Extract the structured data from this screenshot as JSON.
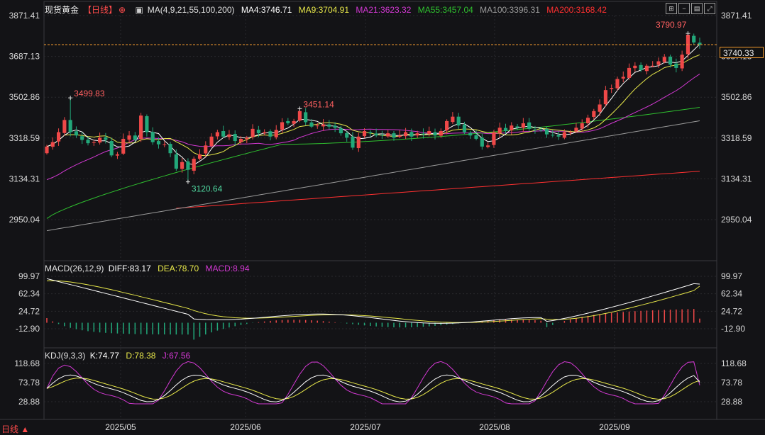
{
  "header": {
    "ticker": "现货黄金",
    "period": "【日线】",
    "period_icon": "target-icon",
    "ma_label": "MA(4,9,21,55,100,200)",
    "ma4": "MA4:3746.71",
    "ma9": "MA9:3704.91",
    "ma21": "MA21:3623.32",
    "ma55": "MA55:3457.04",
    "ma100": "MA100:3396.31",
    "ma200": "MA200:3168.42"
  },
  "toolbar": [
    "layout-icon",
    "minus-icon",
    "panel-icon",
    "expand-icon"
  ],
  "price_tag": "3740.33",
  "macd_header": {
    "label": "MACD(26,12,9)",
    "diff": "DIFF:83.17",
    "dea": "DEA:78.70",
    "macd": "MACD:8.94"
  },
  "kdj_header": {
    "label": "KDJ(9,3,3)",
    "k": "K:74.77",
    "d": "D:78.38",
    "j": "J:67.56"
  },
  "bottom_left": "日线 ▲",
  "colors": {
    "up": "#ef4848",
    "down": "#22a87a",
    "ma4": "#ffffff",
    "ma9": "#e8e84a",
    "ma21": "#d238d2",
    "ma55": "#2fc02f",
    "ma100": "#9a9a9a",
    "ma200": "#ff3030",
    "grid": "#2a2a2e",
    "axis_text": "#d8d8d8"
  },
  "chart_data": [
    {
      "type": "candlestick",
      "name": "price",
      "ticks_left": [
        "3871.41",
        "3687.13",
        "3502.86",
        "3318.59",
        "3134.31",
        "2950.04"
      ],
      "ticks_right": [
        "3871.41",
        "3687.13",
        "3502.86",
        "3318.59",
        "3134.31",
        "2950.04"
      ],
      "x_ticks": [
        "2025/05",
        "2025/06",
        "2025/07",
        "2025/08",
        "2025/09"
      ],
      "annotations": [
        {
          "label": "3499.83",
          "value": 3499.83,
          "color": "#ff6060"
        },
        {
          "label": "3451.14",
          "value": 3451.14,
          "color": "#ff6060"
        },
        {
          "label": "3120.64",
          "value": 3120.64,
          "color": "#4fd8a0"
        },
        {
          "label": "3790.97",
          "value": 3790.97,
          "color": "#ff6060"
        }
      ],
      "reference_line": 3740.33,
      "close": [
        3280,
        3300,
        3345,
        3400,
        3345,
        3330,
        3310,
        3295,
        3300,
        3320,
        3310,
        3240,
        3245,
        3315,
        3330,
        3310,
        3420,
        3345,
        3300,
        3290,
        3290,
        3250,
        3180,
        3210,
        3175,
        3225,
        3245,
        3285,
        3325,
        3345,
        3325,
        3335,
        3305,
        3315,
        3320,
        3360,
        3340,
        3345,
        3325,
        3355,
        3390,
        3385,
        3395,
        3440,
        3390,
        3370,
        3375,
        3380,
        3370,
        3365,
        3340,
        3320,
        3275,
        3325,
        3350,
        3340,
        3330,
        3330,
        3340,
        3320,
        3330,
        3345,
        3325,
        3340,
        3335,
        3350,
        3330,
        3350,
        3395,
        3415,
        3375,
        3345,
        3330,
        3315,
        3280,
        3285,
        3345,
        3365,
        3350,
        3375,
        3365,
        3385,
        3360,
        3355,
        3355,
        3335,
        3330,
        3325,
        3345,
        3345,
        3365,
        3385,
        3410,
        3440,
        3470,
        3535,
        3545,
        3585,
        3595,
        3635,
        3645,
        3625,
        3645,
        3645,
        3665,
        3685,
        3650,
        3635,
        3695,
        3785,
        3750,
        3740
      ]
    },
    {
      "type": "bar",
      "name": "MACD",
      "ticks_left": [
        "99.97",
        "62.34",
        "24.72",
        "-12.90"
      ],
      "ticks_right": [
        "99.97",
        "62.34",
        "24.72",
        "-12.90"
      ],
      "diff_last": 83.17,
      "dea_last": 78.7,
      "macd_last": 8.94
    },
    {
      "type": "line",
      "name": "KDJ",
      "ticks_left": [
        "118.68",
        "73.78",
        "28.88"
      ],
      "ticks_right": [
        "118.68",
        "73.78",
        "28.88"
      ],
      "k_last": 74.77,
      "d_last": 78.38,
      "j_last": 67.56
    }
  ]
}
